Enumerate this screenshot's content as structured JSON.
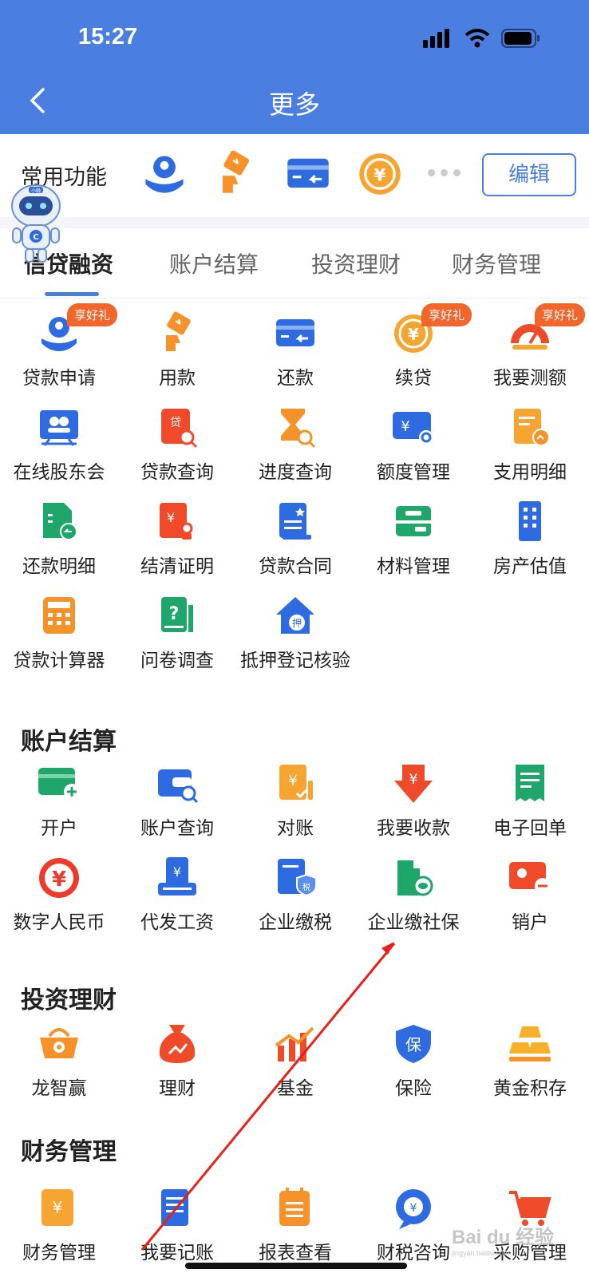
{
  "status_bar": {
    "time": "15:27"
  },
  "header": {
    "title": "更多"
  },
  "common": {
    "label": "常用功能",
    "icons": [
      "loan-apply-icon",
      "use-funds-icon",
      "repay-icon",
      "renew-loan-icon"
    ],
    "edit_label": "编辑"
  },
  "tabs": [
    {
      "label": "信贷融资",
      "active": true
    },
    {
      "label": "账户结算",
      "active": false
    },
    {
      "label": "投资理财",
      "active": false
    },
    {
      "label": "财务管理",
      "active": false
    }
  ],
  "loan_items": [
    {
      "label": "贷款申请",
      "icon": "loan-apply-icon",
      "badge": "享好礼"
    },
    {
      "label": "用款",
      "icon": "use-funds-icon"
    },
    {
      "label": "还款",
      "icon": "repay-icon"
    },
    {
      "label": "续贷",
      "icon": "renew-loan-icon",
      "badge": "享好礼"
    },
    {
      "label": "我要测额",
      "icon": "speedometer-icon",
      "badge": "享好礼"
    },
    {
      "label": "在线股东会",
      "icon": "meeting-icon"
    },
    {
      "label": "贷款查询",
      "icon": "loan-query-icon"
    },
    {
      "label": "进度查询",
      "icon": "hourglass-icon"
    },
    {
      "label": "额度管理",
      "icon": "quota-icon"
    },
    {
      "label": "支用明细",
      "icon": "usage-detail-icon"
    },
    {
      "label": "还款明细",
      "icon": "repay-detail-icon"
    },
    {
      "label": "结清证明",
      "icon": "settlement-cert-icon"
    },
    {
      "label": "贷款合同",
      "icon": "contract-icon"
    },
    {
      "label": "材料管理",
      "icon": "folder-icon"
    },
    {
      "label": "房产估值",
      "icon": "building-icon"
    },
    {
      "label": "贷款计算器",
      "icon": "calculator-icon"
    },
    {
      "label": "问卷调查",
      "icon": "questionnaire-icon"
    },
    {
      "label": "抵押登记核验",
      "icon": "mortgage-house-icon"
    }
  ],
  "account_section": {
    "title": "账户结算",
    "items": [
      {
        "label": "开户",
        "icon": "open-account-icon"
      },
      {
        "label": "账户查询",
        "icon": "wallet-search-icon"
      },
      {
        "label": "对账",
        "icon": "reconcile-icon"
      },
      {
        "label": "我要收款",
        "icon": "receive-money-icon"
      },
      {
        "label": "电子回单",
        "icon": "receipt-icon"
      },
      {
        "label": "数字人民币",
        "icon": "digital-rmb-icon"
      },
      {
        "label": "代发工资",
        "icon": "payroll-icon"
      },
      {
        "label": "企业缴税",
        "icon": "tax-icon"
      },
      {
        "label": "企业缴社保",
        "icon": "social-security-icon"
      },
      {
        "label": "销户",
        "icon": "close-account-icon"
      }
    ]
  },
  "invest_section": {
    "title": "投资理财",
    "items": [
      {
        "label": "龙智赢",
        "icon": "basket-icon"
      },
      {
        "label": "理财",
        "icon": "money-bag-icon"
      },
      {
        "label": "基金",
        "icon": "fund-chart-icon"
      },
      {
        "label": "保险",
        "icon": "insurance-shield-icon"
      },
      {
        "label": "黄金积存",
        "icon": "gold-bars-icon"
      }
    ]
  },
  "finance_section": {
    "title": "财务管理",
    "items": [
      {
        "label": "财务管理",
        "icon": "finance-doc-icon"
      },
      {
        "label": "我要记账",
        "icon": "bookkeeping-icon"
      },
      {
        "label": "报表查看",
        "icon": "report-icon"
      },
      {
        "label": "财税咨询",
        "icon": "tax-consult-icon"
      },
      {
        "label": "采购管理",
        "icon": "shopping-cart-icon"
      }
    ]
  },
  "colors": {
    "brand": "#4a7ee0",
    "orange": "#f5922a",
    "red": "#ef4a2a",
    "green": "#1fa66a",
    "badge": "#f2652b"
  }
}
